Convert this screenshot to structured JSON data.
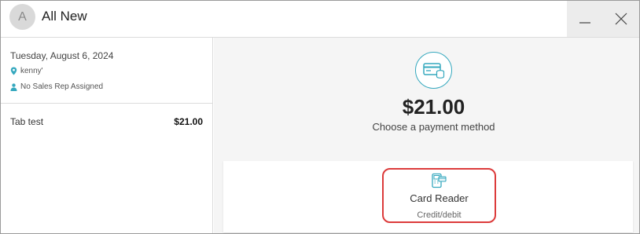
{
  "window": {
    "avatar_letter": "A",
    "title": "All New",
    "minimize_icon": "minimize-icon",
    "close_icon": "close-icon"
  },
  "order": {
    "date": "Tuesday, August 6, 2024",
    "location": "kenny'",
    "location_icon": "map-pin-icon",
    "sales_rep": "No Sales Rep Assigned",
    "sales_rep_icon": "person-icon",
    "tabs": [
      {
        "name": "Tab test",
        "amount": "$21.00"
      }
    ]
  },
  "payment": {
    "icon": "card-payment-icon",
    "amount": "$21.00",
    "prompt": "Choose a payment method",
    "methods": [
      {
        "icon": "card-reader-icon",
        "label": "Card Reader",
        "sublabel": "Credit/debit",
        "highlighted": true
      }
    ]
  },
  "colors": {
    "accent": "#35a8be",
    "highlight_border": "#dc3b3b"
  }
}
